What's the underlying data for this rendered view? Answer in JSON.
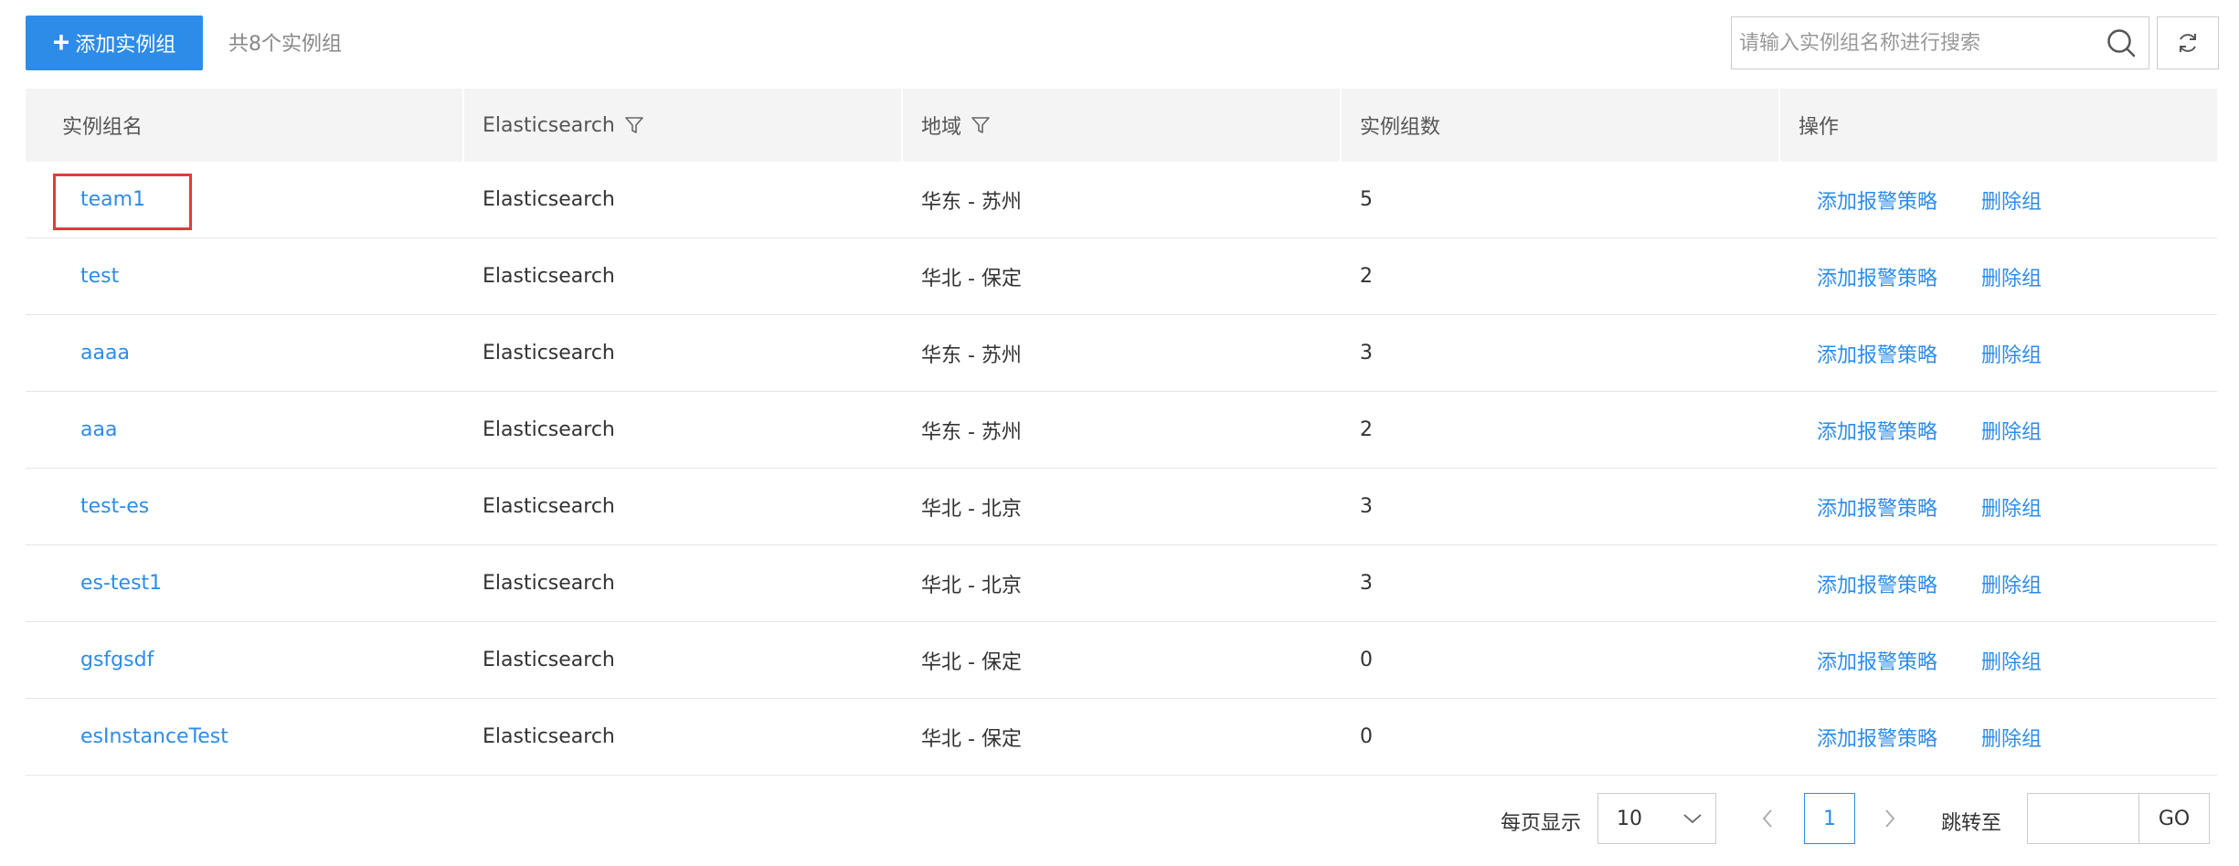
{
  "toolbar": {
    "add_button_label": "添加实例组",
    "count_text": "共8个实例组",
    "search_placeholder": "请输入实例组名称进行搜索"
  },
  "table": {
    "columns": [
      {
        "label": "实例组名",
        "filterable": false
      },
      {
        "label": "Elasticsearch",
        "filterable": true
      },
      {
        "label": "地域",
        "filterable": true
      },
      {
        "label": "实例组数",
        "filterable": false
      },
      {
        "label": "操作",
        "filterable": false
      }
    ],
    "rows": [
      {
        "name": "team1",
        "product": "Elasticsearch",
        "region": "华东 - 苏州",
        "count": "5",
        "action_alert": "添加报警策略",
        "action_delete": "删除组"
      },
      {
        "name": "test",
        "product": "Elasticsearch",
        "region": "华北 - 保定",
        "count": "2",
        "action_alert": "添加报警策略",
        "action_delete": "删除组"
      },
      {
        "name": "aaaa",
        "product": "Elasticsearch",
        "region": "华东 - 苏州",
        "count": "3",
        "action_alert": "添加报警策略",
        "action_delete": "删除组"
      },
      {
        "name": "aaa",
        "product": "Elasticsearch",
        "region": "华东 - 苏州",
        "count": "2",
        "action_alert": "添加报警策略",
        "action_delete": "删除组"
      },
      {
        "name": "test-es",
        "product": "Elasticsearch",
        "region": "华北 - 北京",
        "count": "3",
        "action_alert": "添加报警策略",
        "action_delete": "删除组"
      },
      {
        "name": "es-test1",
        "product": "Elasticsearch",
        "region": "华北 - 北京",
        "count": "3",
        "action_alert": "添加报警策略",
        "action_delete": "删除组"
      },
      {
        "name": "gsfgsdf",
        "product": "Elasticsearch",
        "region": "华北 - 保定",
        "count": "0",
        "action_alert": "添加报警策略",
        "action_delete": "删除组"
      },
      {
        "name": "esInstanceTest",
        "product": "Elasticsearch",
        "region": "华北 - 保定",
        "count": "0",
        "action_alert": "添加报警策略",
        "action_delete": "删除组"
      }
    ]
  },
  "pagination": {
    "page_size_label": "每页显示",
    "page_size": "10",
    "current_page": "1",
    "jump_label": "跳转至",
    "go_label": "GO"
  },
  "colors": {
    "primary": "#2d8ce8",
    "highlight": "#e03b3b",
    "header_bg": "#f4f4f4"
  },
  "icons": {
    "add": "plus-icon",
    "search": "search-icon",
    "refresh": "refresh-icon",
    "filter": "filter-icon",
    "prev": "chevron-left-icon",
    "next": "chevron-right-icon",
    "dropdown": "chevron-down-icon"
  }
}
